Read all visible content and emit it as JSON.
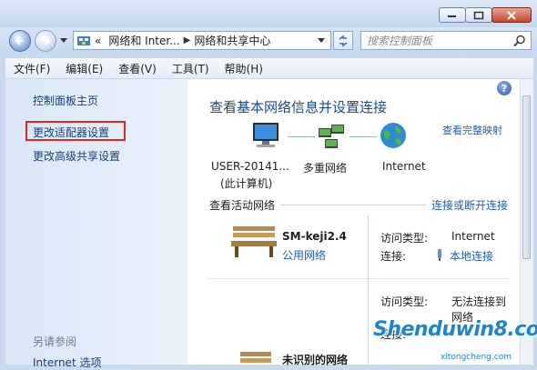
{
  "address": {
    "prefix": "«",
    "crumb1": "网络和 Inter...",
    "crumb2": "网络和共享中心"
  },
  "search": {
    "placeholder": "搜索控制面板"
  },
  "menu": [
    "文件(F)",
    "编辑(E)",
    "查看(V)",
    "工具(T)",
    "帮助(H)"
  ],
  "sidebar": {
    "home": "控制面板主页",
    "adapter": "更改适配器设置",
    "advanced": "更改高级共享设置",
    "see_also": "另请参阅",
    "internet_options": "Internet 选项"
  },
  "main": {
    "heading": "查看基本网络信息并设置连接",
    "full_map": "查看完整映射",
    "node1_line1": "USER-20141...",
    "node1_line2": "(此计算机)",
    "node2": "多重网络",
    "node3": "Internet",
    "active_title": "查看活动网络",
    "connect_link": "连接或断开连接",
    "net1_name": "SM-keji2.4",
    "net1_type": "公用网络",
    "access_label": "访问类型:",
    "access_value1": "Internet",
    "conn_label": "连接:",
    "conn_value": "本地连接",
    "access_value2_line1": "无法连接到",
    "access_value2_line2": "网络",
    "net2_name": "未识别的网络"
  },
  "watermark": {
    "main": "Shenduwin8.com",
    "sub": "xitongcheng.com"
  },
  "colors": {
    "link": "#1f5fb5",
    "highlight": "#e0281c"
  }
}
